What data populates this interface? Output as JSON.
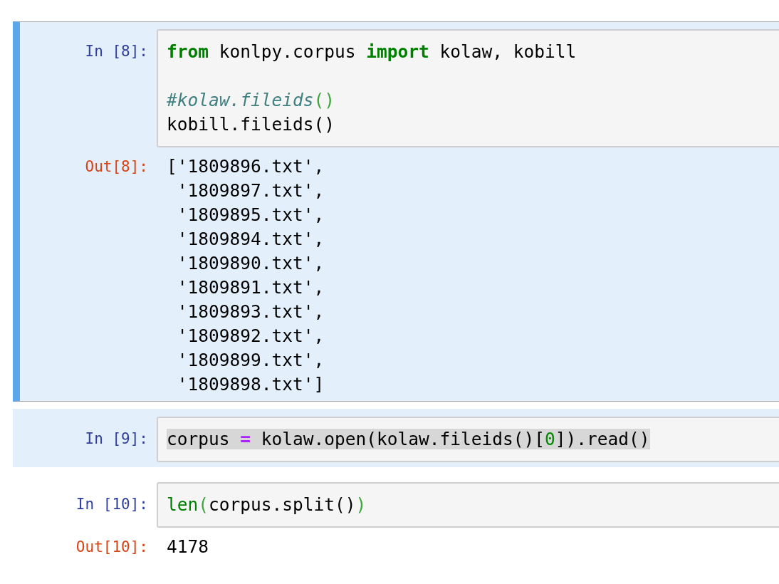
{
  "cells": [
    {
      "prompt_in": "In [8]:",
      "selected": true,
      "focused": true,
      "input": [
        {
          "kind": "code",
          "tokens": [
            {
              "text": "from",
              "kind": "keyword"
            },
            {
              "text": " konlpy.corpus ",
              "kind": "plain"
            },
            {
              "text": "import",
              "kind": "keyword"
            },
            {
              "text": " kolaw, kobill",
              "kind": "plain"
            }
          ]
        },
        {
          "kind": "blank"
        },
        {
          "kind": "code",
          "tokens": [
            {
              "text": "#kolaw.fileids",
              "kind": "comment"
            },
            {
              "text": "()",
              "kind": "paren"
            }
          ]
        },
        {
          "kind": "code",
          "tokens": [
            {
              "text": "kobill.fileids()",
              "kind": "plain"
            }
          ]
        }
      ],
      "highlighted": false,
      "prompt_out": "Out[8]:",
      "output": [
        "['1809896.txt',",
        " '1809897.txt',",
        " '1809895.txt',",
        " '1809894.txt',",
        " '1809890.txt',",
        " '1809891.txt',",
        " '1809893.txt',",
        " '1809892.txt',",
        " '1809899.txt',",
        " '1809898.txt']"
      ]
    },
    {
      "prompt_in": "In [9]:",
      "selected": true,
      "focused": false,
      "highlighted": true,
      "input": [
        {
          "kind": "code",
          "tokens": [
            {
              "text": "corpus ",
              "kind": "plain"
            },
            {
              "text": "=",
              "kind": "operator"
            },
            {
              "text": " kolaw.open(kolaw.fileids()[",
              "kind": "plain"
            },
            {
              "text": "0",
              "kind": "number"
            },
            {
              "text": "]).read()",
              "kind": "plain"
            }
          ]
        }
      ]
    },
    {
      "prompt_in": "In [10]:",
      "selected": false,
      "focused": false,
      "highlighted": false,
      "input": [
        {
          "kind": "code",
          "tokens": [
            {
              "text": "len",
              "kind": "builtin"
            },
            {
              "text": "(",
              "kind": "paren"
            },
            {
              "text": "corpus.split()",
              "kind": "plain"
            },
            {
              "text": ")",
              "kind": "paren"
            }
          ]
        }
      ],
      "prompt_out": "Out[10]:",
      "output": [
        "4178"
      ]
    }
  ]
}
